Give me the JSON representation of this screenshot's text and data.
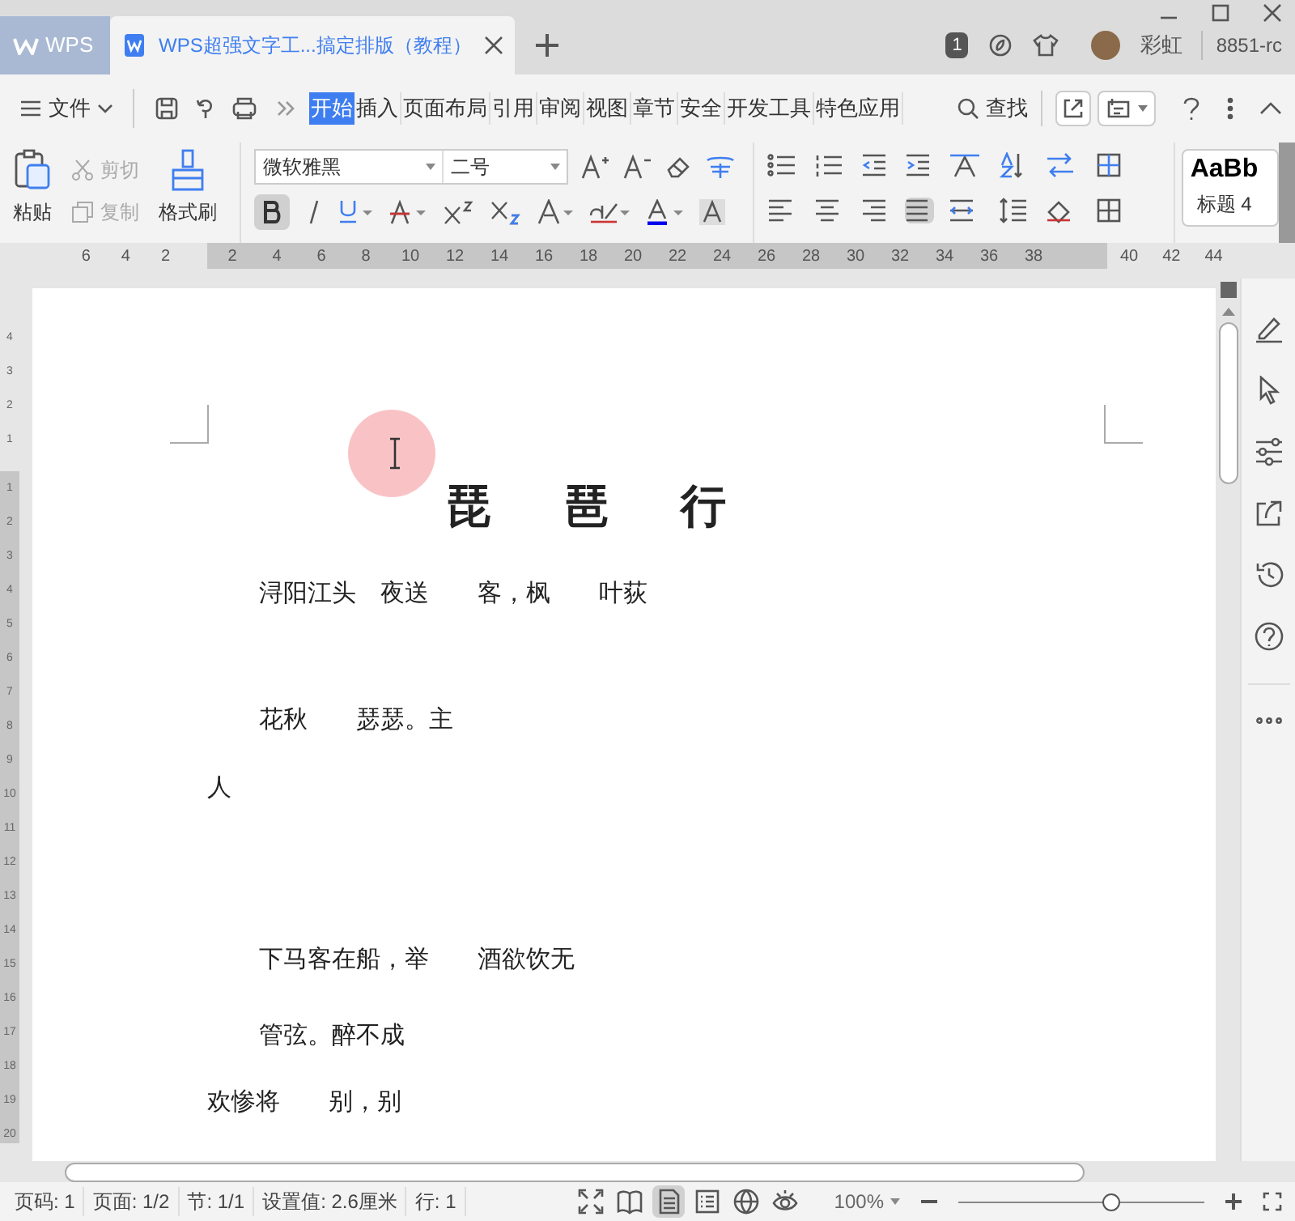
{
  "title_bar": {
    "app_tab": "WPS",
    "doc_tab": {
      "title": "WPS超强文字工...搞定排版（教程）",
      "selected": true
    },
    "badge": "1",
    "user": "彩虹",
    "account": "8851-rc"
  },
  "menu_bar": {
    "file": "文件",
    "tabs": [
      {
        "label": "开始",
        "selected": true
      },
      {
        "label": "插入",
        "selected": false
      },
      {
        "label": "页面布局",
        "selected": false
      },
      {
        "label": "引用",
        "selected": false
      },
      {
        "label": "审阅",
        "selected": false
      },
      {
        "label": "视图",
        "selected": false
      },
      {
        "label": "章节",
        "selected": false
      },
      {
        "label": "安全",
        "selected": false
      },
      {
        "label": "开发工具",
        "selected": false
      },
      {
        "label": "特色应用",
        "selected": false
      }
    ],
    "search": "查找"
  },
  "ribbon": {
    "paste": "粘贴",
    "cut": "剪切",
    "copy": "复制",
    "format_painter": "格式刷",
    "font": "微软雅黑",
    "size": "二号",
    "bold": true,
    "style_preview": "AaBb",
    "style_name": "标题 4"
  },
  "ruler": {
    "left_ticks": [
      "6",
      "4",
      "2"
    ],
    "ticks": [
      "2",
      "4",
      "6",
      "8",
      "10",
      "12",
      "14",
      "16",
      "18",
      "20",
      "22",
      "24",
      "26",
      "28",
      "30",
      "32",
      "34",
      "36",
      "38"
    ],
    "right_ticks": [
      "40",
      "42",
      "44"
    ]
  },
  "vertical_ruler": {
    "top_ticks": [
      "4",
      "3",
      "2",
      "1"
    ],
    "ticks": [
      "1",
      "2",
      "3",
      "4",
      "5",
      "6",
      "7",
      "8",
      "9",
      "10",
      "11",
      "12",
      "13",
      "14",
      "15",
      "16",
      "17",
      "18",
      "19",
      "20"
    ]
  },
  "document": {
    "title": "琵琶行",
    "lines": [
      "浔阳江头　夜送　　客，枫　　叶荻",
      "花秋　　瑟瑟。主",
      "人",
      "下马客在船，举　　酒欲饮无",
      "管弦。醉不成",
      "欢惨将　　别，别"
    ]
  },
  "status_bar": {
    "items": [
      "页码: 1",
      "页面: 1/2",
      "节: 1/1",
      "设置值: 2.6厘米",
      "行: 1"
    ],
    "zoom": "100%",
    "zoom_slider": {
      "level": 0.62
    },
    "views": [
      {
        "kind": "fullscreen",
        "selected": false
      },
      {
        "kind": "read",
        "selected": false
      },
      {
        "kind": "page",
        "selected": true
      },
      {
        "kind": "outline",
        "selected": false
      },
      {
        "kind": "web",
        "selected": false
      },
      {
        "kind": "eye",
        "selected": false
      }
    ]
  }
}
